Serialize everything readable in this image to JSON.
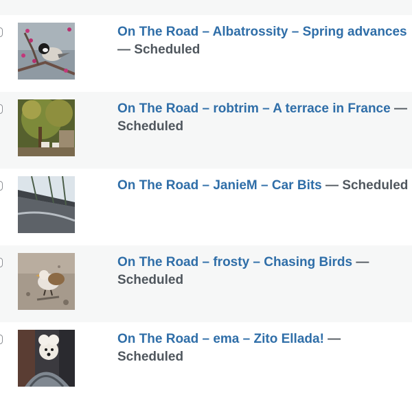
{
  "posts": [
    {
      "title": "On The Road – Albatrossity – Spring advances",
      "separator": " — ",
      "status": "Scheduled",
      "thumbnail": "chickadee-on-blossom-branch"
    },
    {
      "title": "On The Road – robtrim – A terrace in France",
      "separator": " — ",
      "status": "Scheduled",
      "thumbnail": "garden-terrace-with-tree"
    },
    {
      "title": "On The Road – JanieM – Car Bits",
      "separator": " — ",
      "status": "Scheduled",
      "thumbnail": "car-windshield-closeup"
    },
    {
      "title": "On The Road – frosty – Chasing Birds",
      "separator": " — ",
      "status": "Scheduled",
      "thumbnail": "snow-bunting-on-ground"
    },
    {
      "title": "On The Road – ema – Zito Ellada!",
      "separator": " — ",
      "status": "Scheduled",
      "thumbnail": "dog-in-carrier"
    }
  ],
  "colors": {
    "link": "#2f6ea8",
    "status_text": "#50575e",
    "row_alt_background": "#f6f7f7",
    "row_background": "#ffffff"
  }
}
